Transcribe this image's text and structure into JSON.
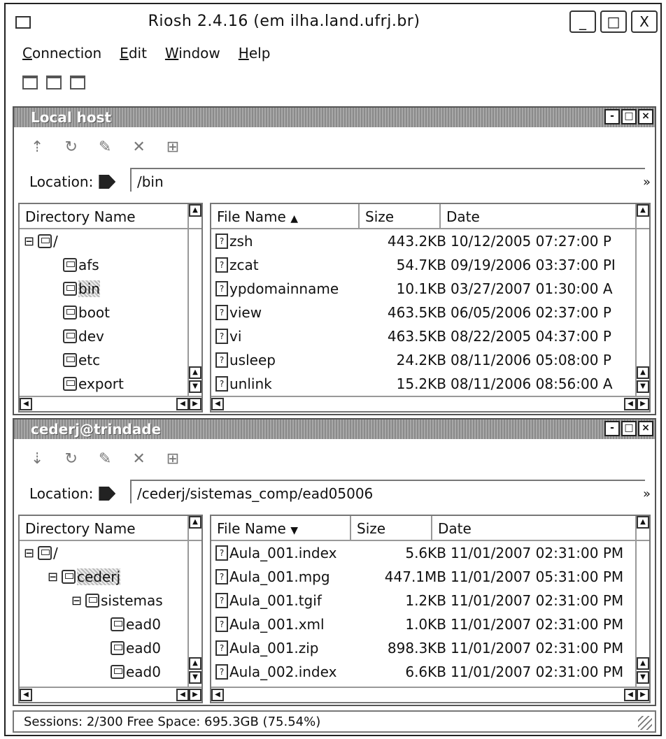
{
  "window": {
    "title": "Riosh 2.4.16 (em ilha.land.ufrj.br)",
    "buttons": [
      "_",
      "□",
      "X"
    ]
  },
  "menu": [
    {
      "label": "Connection",
      "underline": "C"
    },
    {
      "label": "Edit",
      "underline": "E"
    },
    {
      "label": "Window",
      "underline": "W"
    },
    {
      "label": "Help",
      "underline": "H"
    }
  ],
  "local": {
    "title": "Local host",
    "toolbar_icons": [
      "upload-icon",
      "refresh-icon",
      "rename-icon",
      "delete-icon",
      "mkdir-icon"
    ],
    "location_label": "Location:",
    "location_value": "/bin",
    "dir_header": "Directory Name",
    "tree": [
      {
        "label": "/",
        "depth": 0,
        "expander": "⊟"
      },
      {
        "label": "afs",
        "depth": 1
      },
      {
        "label": "bin",
        "depth": 1,
        "selected": true
      },
      {
        "label": "boot",
        "depth": 1
      },
      {
        "label": "dev",
        "depth": 1
      },
      {
        "label": "etc",
        "depth": 1
      },
      {
        "label": "export",
        "depth": 1
      }
    ],
    "file_headers": {
      "name": "File Name",
      "size": "Size",
      "date": "Date",
      "sort": "▲"
    },
    "files": [
      {
        "name": "zsh",
        "size": "443.2KB",
        "date": "10/12/2005 07:27:00 P"
      },
      {
        "name": "zcat",
        "size": "54.7KB",
        "date": "09/19/2006 03:37:00 PI"
      },
      {
        "name": "ypdomainname",
        "size": "10.1KB",
        "date": "03/27/2007 01:30:00 A"
      },
      {
        "name": "view",
        "size": "463.5KB",
        "date": "06/05/2006 02:37:00 P"
      },
      {
        "name": "vi",
        "size": "463.5KB",
        "date": "08/22/2005 04:37:00 P"
      },
      {
        "name": "usleep",
        "size": "24.2KB",
        "date": "08/11/2006 05:08:00 P"
      },
      {
        "name": "unlink",
        "size": "15.2KB",
        "date": "08/11/2006 08:56:00 A"
      }
    ]
  },
  "remote": {
    "title": "cederj@trindade",
    "toolbar_icons": [
      "download-icon",
      "refresh-icon",
      "rename-icon",
      "delete-icon",
      "mkdir-icon"
    ],
    "location_label": "Location:",
    "location_value": "/cederj/sistemas_comp/ead05006",
    "dir_header": "Directory Name",
    "tree": [
      {
        "label": "/",
        "depth": 0,
        "expander": "⊟"
      },
      {
        "label": "cederj",
        "depth": 1,
        "expander": "⊟",
        "selected": true
      },
      {
        "label": "sistemas",
        "depth": 2,
        "expander": "⊟"
      },
      {
        "label": "ead0",
        "depth": 3
      },
      {
        "label": "ead0",
        "depth": 3
      },
      {
        "label": "ead0",
        "depth": 3
      }
    ],
    "file_headers": {
      "name": "File Name",
      "size": "Size",
      "date": "Date",
      "sort": "▼"
    },
    "files": [
      {
        "name": "Aula_001.index",
        "size": "5.6KB",
        "date": "11/01/2007 02:31:00 PM"
      },
      {
        "name": "Aula_001.mpg",
        "size": "447.1MB",
        "date": "11/01/2007 05:31:00 PM"
      },
      {
        "name": "Aula_001.tgif",
        "size": "1.2KB",
        "date": "11/01/2007 02:31:00 PM"
      },
      {
        "name": "Aula_001.xml",
        "size": "1.0KB",
        "date": "11/01/2007 02:31:00 PM"
      },
      {
        "name": "Aula_001.zip",
        "size": "898.3KB",
        "date": "11/01/2007 02:31:00 PM"
      },
      {
        "name": "Aula_002.index",
        "size": "6.6KB",
        "date": "11/01/2007 02:31:00 PM"
      }
    ]
  },
  "status": {
    "text": "Sessions: 2/300  Free Space: 695.3GB (75.54%)"
  }
}
